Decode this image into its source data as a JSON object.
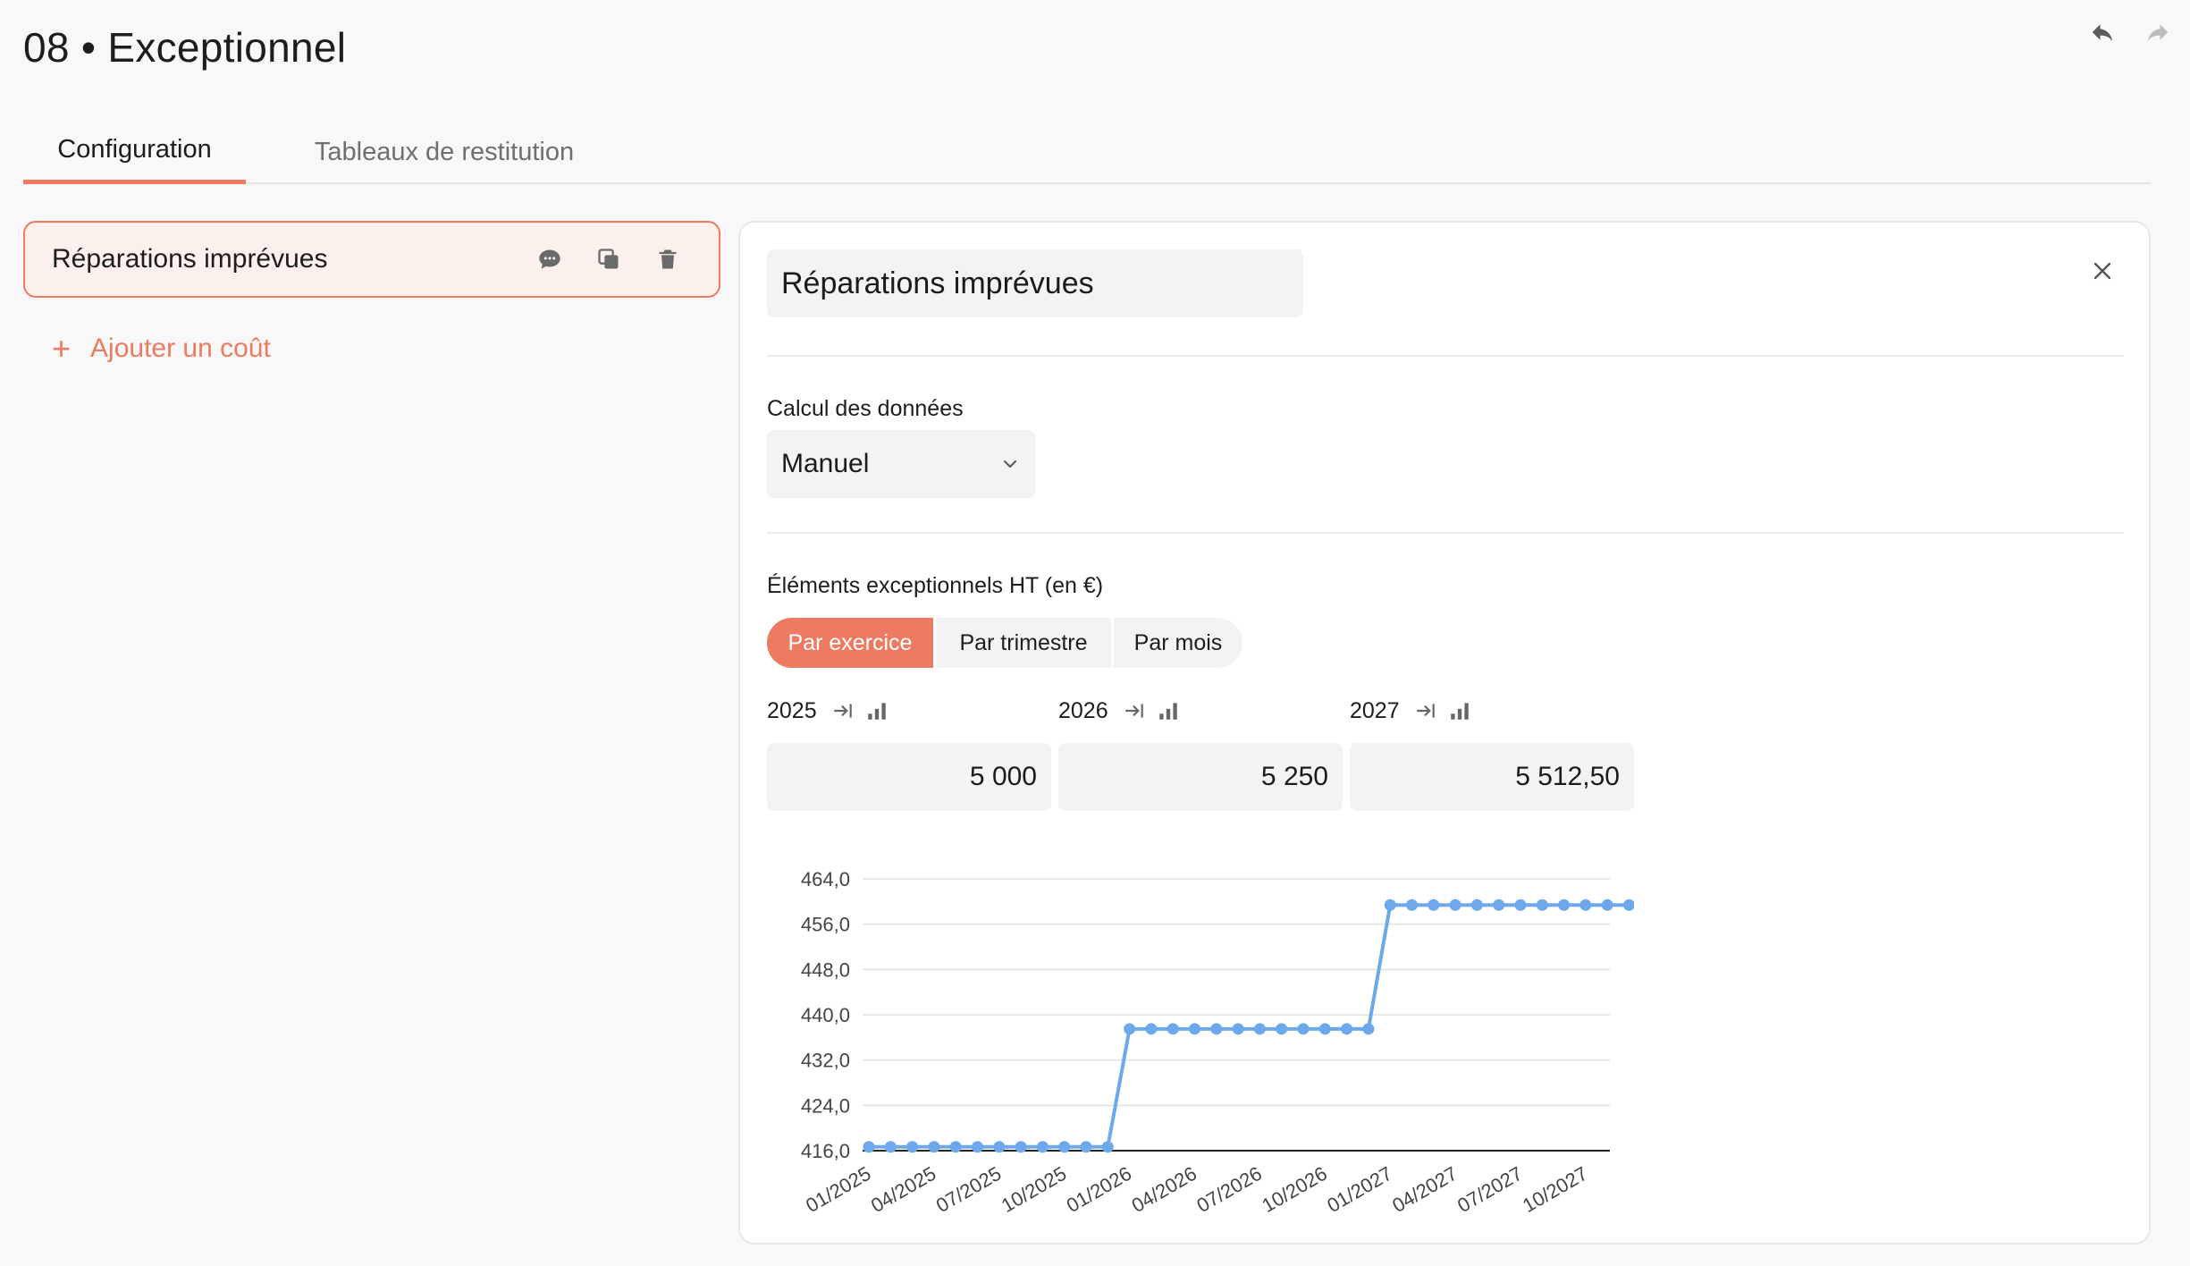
{
  "page": {
    "title": "08 • Exceptionnel"
  },
  "toolbar": {
    "undo_icon": "undo-icon",
    "redo_icon": "redo-icon"
  },
  "tabs": [
    {
      "label": "Configuration",
      "active": true
    },
    {
      "label": "Tableaux de restitution",
      "active": false
    }
  ],
  "sidebar": {
    "cost_item": {
      "label": "Réparations imprévues",
      "icons": [
        "comment-icon",
        "duplicate-icon",
        "trash-icon"
      ]
    },
    "add_label": "Ajouter un coût",
    "add_icon": "+"
  },
  "panel": {
    "name_value": "Réparations imprévues",
    "calc_label": "Calcul des données",
    "calc_value": "Manuel",
    "section_title": "Éléments exceptionnels HT (en €)",
    "periods": [
      {
        "label": "Par exercice",
        "active": true
      },
      {
        "label": "Par trimestre",
        "active": false
      },
      {
        "label": "Par mois",
        "active": false
      }
    ],
    "years": [
      {
        "year": "2025",
        "value": "5 000"
      },
      {
        "year": "2026",
        "value": "5 250"
      },
      {
        "year": "2027",
        "value": "5 512,50"
      }
    ]
  },
  "colors": {
    "accent": "#ec7b62",
    "accent_bg": "#fcf0ed",
    "series": "#6ea8ec",
    "field_bg": "#f3f3f5"
  },
  "chart_data": {
    "type": "line",
    "x": [
      "01/2025",
      "02/2025",
      "03/2025",
      "04/2025",
      "05/2025",
      "06/2025",
      "07/2025",
      "08/2025",
      "09/2025",
      "10/2025",
      "11/2025",
      "12/2025",
      "01/2026",
      "02/2026",
      "03/2026",
      "04/2026",
      "05/2026",
      "06/2026",
      "07/2026",
      "08/2026",
      "09/2026",
      "10/2026",
      "11/2026",
      "12/2026",
      "01/2027",
      "02/2027",
      "03/2027",
      "04/2027",
      "05/2027",
      "06/2027",
      "07/2027",
      "08/2027",
      "09/2027",
      "10/2027",
      "11/2027",
      "12/2027"
    ],
    "x_tick_labels": [
      "01/2025",
      "04/2025",
      "07/2025",
      "10/2025",
      "01/2026",
      "04/2026",
      "07/2026",
      "10/2026",
      "01/2027",
      "04/2027",
      "07/2027",
      "10/2027"
    ],
    "series": [
      {
        "values": [
          416.67,
          416.67,
          416.67,
          416.67,
          416.67,
          416.67,
          416.67,
          416.67,
          416.67,
          416.67,
          416.67,
          416.67,
          437.5,
          437.5,
          437.5,
          437.5,
          437.5,
          437.5,
          437.5,
          437.5,
          437.5,
          437.5,
          437.5,
          437.5,
          459.38,
          459.38,
          459.38,
          459.38,
          459.38,
          459.38,
          459.38,
          459.38,
          459.38,
          459.38,
          459.38,
          459.38
        ]
      }
    ],
    "y_tick_labels": [
      "416,0",
      "424,0",
      "432,0",
      "440,0",
      "448,0",
      "456,0",
      "464,0"
    ],
    "y_ticks": [
      416,
      424,
      432,
      440,
      448,
      456,
      464
    ],
    "ylim": [
      416,
      464
    ],
    "grid": true,
    "legend": "none"
  }
}
